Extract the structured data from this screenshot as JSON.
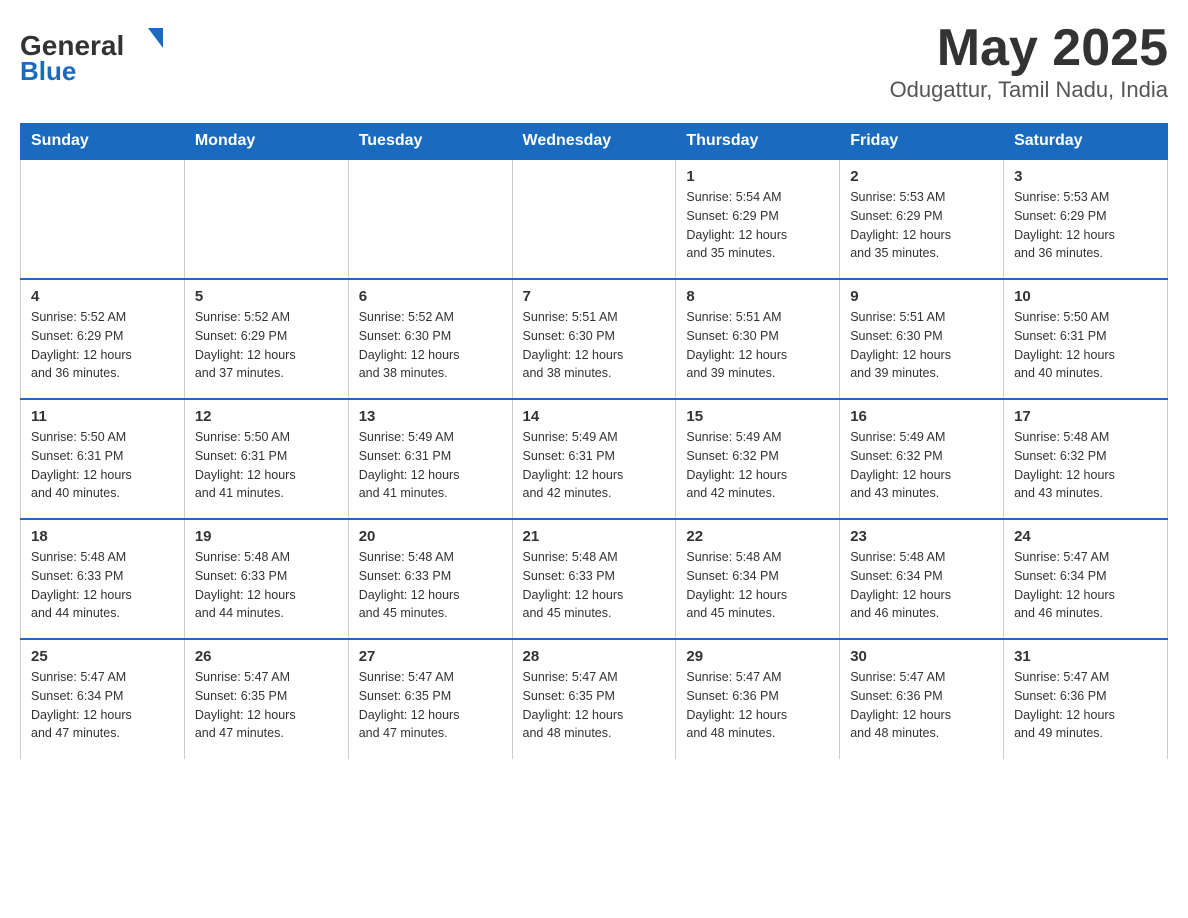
{
  "header": {
    "logo_general": "General",
    "logo_blue": "Blue",
    "month_title": "May 2025",
    "location": "Odugattur, Tamil Nadu, India"
  },
  "weekdays": [
    "Sunday",
    "Monday",
    "Tuesday",
    "Wednesday",
    "Thursday",
    "Friday",
    "Saturday"
  ],
  "weeks": [
    [
      {
        "day": "",
        "info": ""
      },
      {
        "day": "",
        "info": ""
      },
      {
        "day": "",
        "info": ""
      },
      {
        "day": "",
        "info": ""
      },
      {
        "day": "1",
        "info": "Sunrise: 5:54 AM\nSunset: 6:29 PM\nDaylight: 12 hours\nand 35 minutes."
      },
      {
        "day": "2",
        "info": "Sunrise: 5:53 AM\nSunset: 6:29 PM\nDaylight: 12 hours\nand 35 minutes."
      },
      {
        "day": "3",
        "info": "Sunrise: 5:53 AM\nSunset: 6:29 PM\nDaylight: 12 hours\nand 36 minutes."
      }
    ],
    [
      {
        "day": "4",
        "info": "Sunrise: 5:52 AM\nSunset: 6:29 PM\nDaylight: 12 hours\nand 36 minutes."
      },
      {
        "day": "5",
        "info": "Sunrise: 5:52 AM\nSunset: 6:29 PM\nDaylight: 12 hours\nand 37 minutes."
      },
      {
        "day": "6",
        "info": "Sunrise: 5:52 AM\nSunset: 6:30 PM\nDaylight: 12 hours\nand 38 minutes."
      },
      {
        "day": "7",
        "info": "Sunrise: 5:51 AM\nSunset: 6:30 PM\nDaylight: 12 hours\nand 38 minutes."
      },
      {
        "day": "8",
        "info": "Sunrise: 5:51 AM\nSunset: 6:30 PM\nDaylight: 12 hours\nand 39 minutes."
      },
      {
        "day": "9",
        "info": "Sunrise: 5:51 AM\nSunset: 6:30 PM\nDaylight: 12 hours\nand 39 minutes."
      },
      {
        "day": "10",
        "info": "Sunrise: 5:50 AM\nSunset: 6:31 PM\nDaylight: 12 hours\nand 40 minutes."
      }
    ],
    [
      {
        "day": "11",
        "info": "Sunrise: 5:50 AM\nSunset: 6:31 PM\nDaylight: 12 hours\nand 40 minutes."
      },
      {
        "day": "12",
        "info": "Sunrise: 5:50 AM\nSunset: 6:31 PM\nDaylight: 12 hours\nand 41 minutes."
      },
      {
        "day": "13",
        "info": "Sunrise: 5:49 AM\nSunset: 6:31 PM\nDaylight: 12 hours\nand 41 minutes."
      },
      {
        "day": "14",
        "info": "Sunrise: 5:49 AM\nSunset: 6:31 PM\nDaylight: 12 hours\nand 42 minutes."
      },
      {
        "day": "15",
        "info": "Sunrise: 5:49 AM\nSunset: 6:32 PM\nDaylight: 12 hours\nand 42 minutes."
      },
      {
        "day": "16",
        "info": "Sunrise: 5:49 AM\nSunset: 6:32 PM\nDaylight: 12 hours\nand 43 minutes."
      },
      {
        "day": "17",
        "info": "Sunrise: 5:48 AM\nSunset: 6:32 PM\nDaylight: 12 hours\nand 43 minutes."
      }
    ],
    [
      {
        "day": "18",
        "info": "Sunrise: 5:48 AM\nSunset: 6:33 PM\nDaylight: 12 hours\nand 44 minutes."
      },
      {
        "day": "19",
        "info": "Sunrise: 5:48 AM\nSunset: 6:33 PM\nDaylight: 12 hours\nand 44 minutes."
      },
      {
        "day": "20",
        "info": "Sunrise: 5:48 AM\nSunset: 6:33 PM\nDaylight: 12 hours\nand 45 minutes."
      },
      {
        "day": "21",
        "info": "Sunrise: 5:48 AM\nSunset: 6:33 PM\nDaylight: 12 hours\nand 45 minutes."
      },
      {
        "day": "22",
        "info": "Sunrise: 5:48 AM\nSunset: 6:34 PM\nDaylight: 12 hours\nand 45 minutes."
      },
      {
        "day": "23",
        "info": "Sunrise: 5:48 AM\nSunset: 6:34 PM\nDaylight: 12 hours\nand 46 minutes."
      },
      {
        "day": "24",
        "info": "Sunrise: 5:47 AM\nSunset: 6:34 PM\nDaylight: 12 hours\nand 46 minutes."
      }
    ],
    [
      {
        "day": "25",
        "info": "Sunrise: 5:47 AM\nSunset: 6:34 PM\nDaylight: 12 hours\nand 47 minutes."
      },
      {
        "day": "26",
        "info": "Sunrise: 5:47 AM\nSunset: 6:35 PM\nDaylight: 12 hours\nand 47 minutes."
      },
      {
        "day": "27",
        "info": "Sunrise: 5:47 AM\nSunset: 6:35 PM\nDaylight: 12 hours\nand 47 minutes."
      },
      {
        "day": "28",
        "info": "Sunrise: 5:47 AM\nSunset: 6:35 PM\nDaylight: 12 hours\nand 48 minutes."
      },
      {
        "day": "29",
        "info": "Sunrise: 5:47 AM\nSunset: 6:36 PM\nDaylight: 12 hours\nand 48 minutes."
      },
      {
        "day": "30",
        "info": "Sunrise: 5:47 AM\nSunset: 6:36 PM\nDaylight: 12 hours\nand 48 minutes."
      },
      {
        "day": "31",
        "info": "Sunrise: 5:47 AM\nSunset: 6:36 PM\nDaylight: 12 hours\nand 49 minutes."
      }
    ]
  ]
}
